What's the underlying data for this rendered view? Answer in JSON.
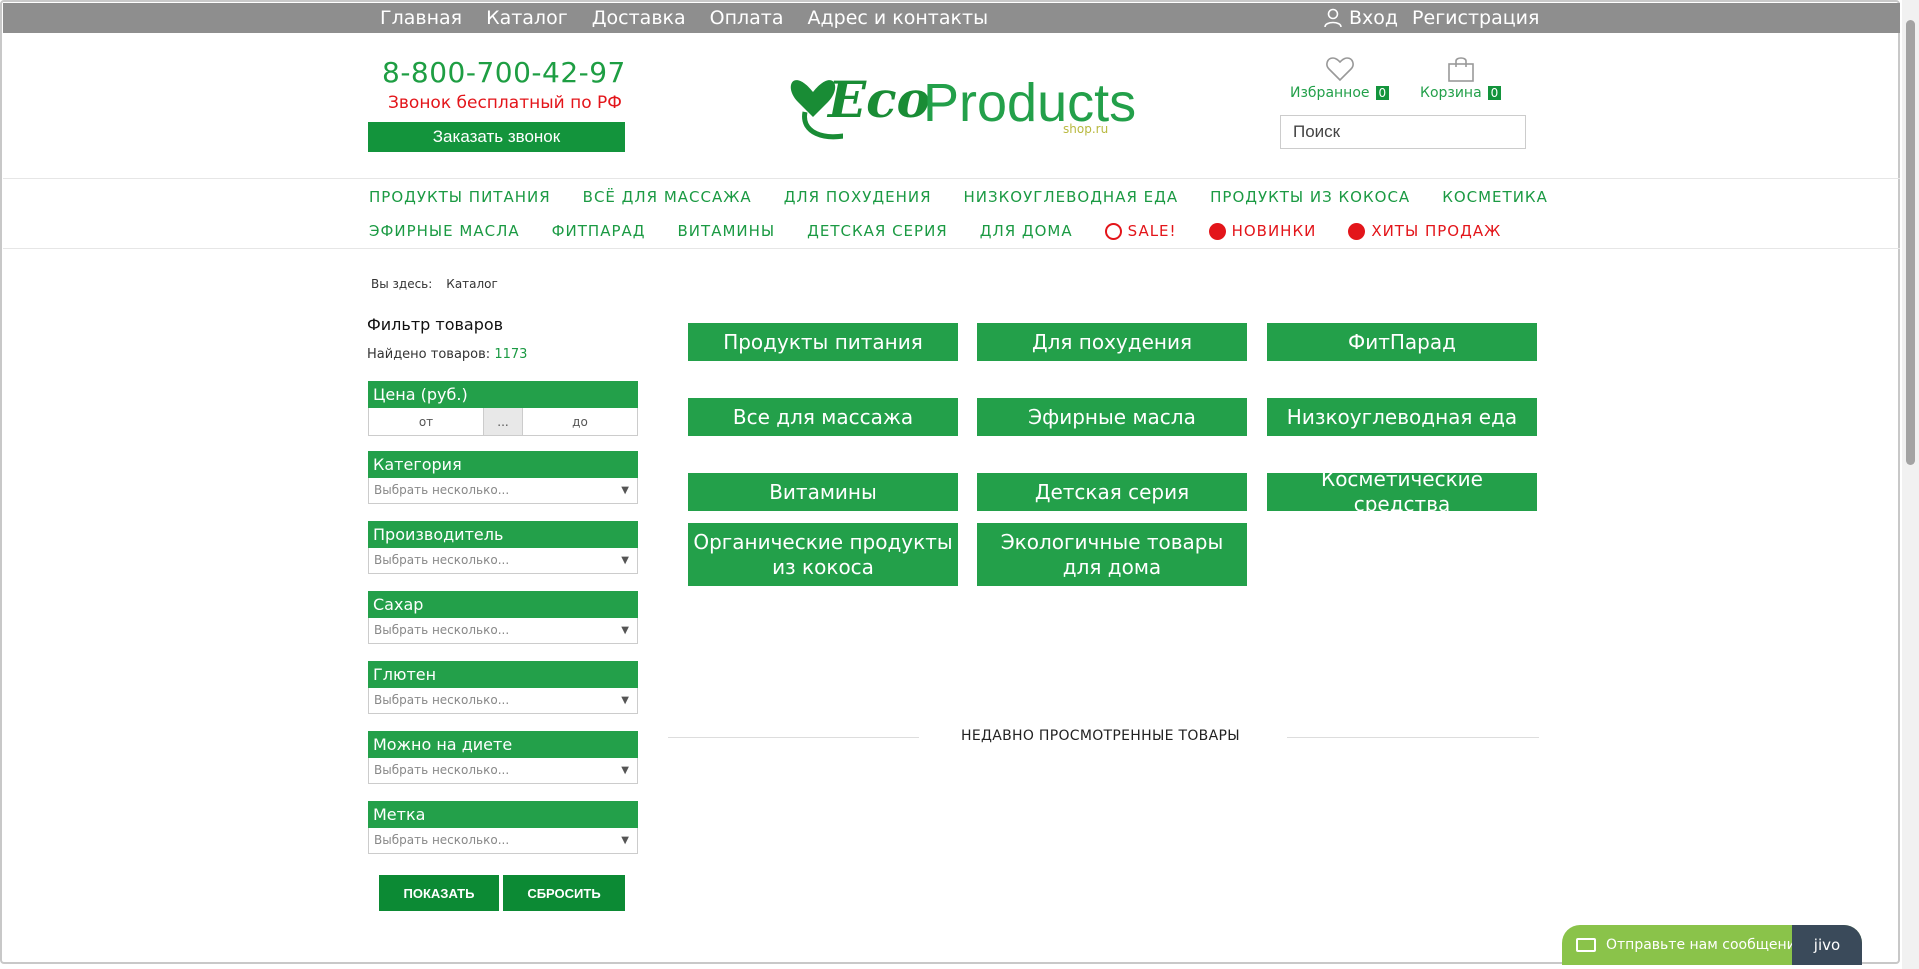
{
  "topnav": {
    "links": [
      "Главная",
      "Каталог",
      "Доставка",
      "Оплата",
      "Адрес и контакты"
    ],
    "login": "Вход",
    "register": "Регистрация"
  },
  "header": {
    "phone": "8-800-700-42-97",
    "free_call": "Звонок бесплатный по РФ",
    "callback_button": "Заказать звонок",
    "logo": {
      "eco": "Eco",
      "products": "Products",
      "shop": "shop.ru"
    },
    "favorites": {
      "label": "Избранное",
      "count": "0"
    },
    "cart": {
      "label": "Корзина",
      "count": "0"
    },
    "search_placeholder": "Поиск"
  },
  "menu": {
    "row1": [
      "ПРОДУКТЫ ПИТАНИЯ",
      "ВСЁ ДЛЯ МАССАЖА",
      "ДЛЯ ПОХУДЕНИЯ",
      "НИЗКОУГЛЕВОДНАЯ ЕДА",
      "ПРОДУКТЫ ИЗ КОКОСА",
      "КОСМЕТИКА"
    ],
    "row2": [
      "ЭФИРНЫЕ МАСЛА",
      "ФИТПАРАД",
      "ВИТАМИНЫ",
      "ДЕТСКАЯ СЕРИЯ",
      "ДЛЯ ДОМА"
    ],
    "sale": "SALE!",
    "new": "НОВИНКИ",
    "hits": "ХИТЫ ПРОДАЖ"
  },
  "breadcrumb": {
    "prefix": "Вы здесь:",
    "current": "Каталог"
  },
  "filter": {
    "title": "Фильтр товаров",
    "found_label": "Найдено товаров:",
    "found_count": "1173",
    "price": {
      "title": "Цена (руб.)",
      "from": "от",
      "mid": "...",
      "to": "до"
    },
    "placeholder": "Выбрать несколько...",
    "groups": [
      "Категория",
      "Производитель",
      "Сахар",
      "Глютен",
      "Можно на диете",
      "Метка"
    ],
    "show_button": "ПОКАЗАТЬ",
    "reset_button": "СБРОСИТЬ"
  },
  "categories": [
    "Продукты питания",
    "Для похудения",
    "ФитПарад",
    "Все для массажа",
    "Эфирные масла",
    "Низкоуглеводная еда",
    "Витамины",
    "Детская серия",
    "Косметические средства",
    "Органические продукты из кокоса",
    "Экологичные товары для дома"
  ],
  "recent_title": "НЕДАВНО ПРОСМОТРЕННЫЕ ТОВАРЫ",
  "jivo": {
    "message": "Отправьте нам сообщение",
    "brand": "jivo"
  },
  "colors": {
    "green": "#23a04a",
    "dark_green": "#0c8a34",
    "red": "#e3151a",
    "topbar": "#8e8e8e"
  }
}
